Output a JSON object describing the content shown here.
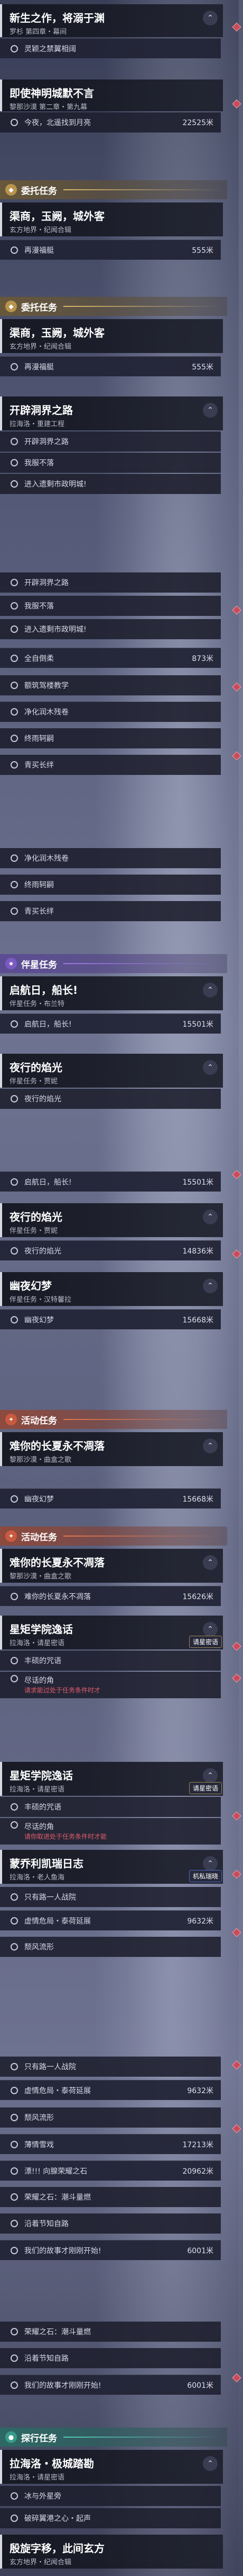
{
  "s1": {
    "card1": {
      "title": "新生之作，将溺于渊",
      "sub": "罗杉 第四章・幕间",
      "collapse": "^"
    },
    "obj1": {
      "text": "灵颖之禁翼相阔",
      "done": true
    },
    "card2": {
      "title": "即使神明城默不言",
      "sub": "黎那沙漠 第二章・第九幕"
    },
    "obj2": {
      "text": "今夜，北遥找到月亮",
      "dist": "22525米"
    }
  },
  "section_commission": {
    "label": "委托任务"
  },
  "s2": {
    "card1": {
      "title": "渠商，玉阙，城外客",
      "sub": "玄方地界・纪闻合辑"
    },
    "obj1": {
      "text": "再漫福艇",
      "dist": "555米"
    }
  },
  "s3": {
    "card1": {
      "title": "渠商，玉阙，城外客",
      "sub": "玄方地界・纪闻合辑"
    },
    "obj1": {
      "text": "再漫福艇",
      "dist": "555米"
    },
    "card2": {
      "title": "开辟洞界之路",
      "sub": "拉海洛・重建工程"
    },
    "objs": [
      {
        "text": "开辟洞界之路"
      },
      {
        "text": "我服不落"
      },
      {
        "text": "进入遗剩市政明城!"
      }
    ]
  },
  "s4": {
    "objs": [
      {
        "text": "开辟洞界之路"
      },
      {
        "text": "我服不落"
      },
      {
        "text": "进入遗剩市政明城!"
      },
      {
        "text": "全自倒柔",
        "dist": "873米"
      },
      {
        "text": "额筑驾楼教学"
      },
      {
        "text": "净化润木残卷"
      },
      {
        "text": "终雨轲嗣"
      },
      {
        "text": "青买长绊"
      }
    ]
  },
  "s5": {
    "objs": [
      {
        "text": "净化润木残卷"
      },
      {
        "text": "终雨轲嗣"
      },
      {
        "text": "青买长绊"
      }
    ]
  },
  "section_companion": {
    "label": "伴星任务"
  },
  "s6": {
    "card1": {
      "title": "启航日，船长!",
      "sub": "伴星任务・布兰特"
    },
    "obj1": {
      "text": "启航日，船长!",
      "dist": "15501米"
    },
    "card2": {
      "title": "夜行的焰光",
      "sub": "伴星任务・贾妮"
    },
    "obj2": {
      "text": "夜行的焰光"
    }
  },
  "s7": {
    "obj1": {
      "text": "启航日，船长!",
      "dist": "15501米"
    },
    "card1": {
      "title": "夜行的焰光",
      "sub": "伴星任务・贾妮"
    },
    "obj2": {
      "text": "夜行的焰光",
      "dist": "14836米"
    },
    "card2": {
      "title": "幽夜幻梦",
      "sub": "伴星任务・汉特馨拉"
    },
    "obj3": {
      "text": "幽夜幻梦",
      "dist": "15668米"
    }
  },
  "section_event": {
    "label": "活动任务"
  },
  "s8": {
    "card1": {
      "title": "难你的长夏永不凋落",
      "sub": "黎那沙漠・曲盒之歌"
    },
    "obj1": {
      "text": "幽夜幻梦",
      "dist": "15668米"
    }
  },
  "s9": {
    "card1": {
      "title": "难你的长夏永不凋落",
      "sub": "黎那沙漠・曲盒之歌"
    },
    "obj1": {
      "text": "难你的长夏永不凋落",
      "dist": "15626米"
    },
    "card2": {
      "title": "星矩学院逸话",
      "sub": "拉海洛・请星密语"
    },
    "tag1": "请星密语",
    "obj2": {
      "text": "丰硕的咒语"
    },
    "obj3": {
      "text": "尽话的角",
      "red": "请求能过处于任务条件时才"
    }
  },
  "s10": {
    "card1": {
      "title": "星矩学院逸话",
      "sub": "拉海洛・请星密语"
    },
    "tag1": "请星密语",
    "obj1": {
      "text": "丰硕的咒语"
    },
    "obj2": {
      "text": "尽话的角",
      "red": "请你取进处于任务条件时才能"
    },
    "card2": {
      "title": "蒙乔利凯瑞日志",
      "sub": "拉海洛・老人鱼海"
    },
    "tag2": "机私瑞晓",
    "obj3": {
      "text": "只有路一人战院"
    },
    "obj4": {
      "text": "虚情危局・泰荷延展",
      "dist": "9632米"
    },
    "obj5": {
      "text": "颓风流形"
    }
  },
  "s11": {
    "objs": [
      {
        "text": "只有路一人战院"
      },
      {
        "text": "虚情危局・泰荷延展",
        "dist": "9632米"
      },
      {
        "text": "颓风流形"
      },
      {
        "text": "薄情雪戏",
        "dist": "17213米"
      },
      {
        "text": "漂!!! 向腺荣耀之石",
        "dist": "20962米"
      },
      {
        "text": "荣耀之石：潮斗量燃"
      },
      {
        "text": "沿着节知自路"
      },
      {
        "text": "我们的故事才刚刚开始!",
        "dist": "6001米"
      }
    ]
  },
  "s12": {
    "objs": [
      {
        "text": "荣耀之石：潮斗量燃"
      },
      {
        "text": "沿着节知自路"
      },
      {
        "text": "我们的故事才刚刚开始!",
        "dist": "6001米"
      }
    ]
  },
  "section_explore": {
    "label": "探行任务"
  },
  "s13": {
    "card1": {
      "title": "拉海洛・极城踏勘",
      "sub": "拉海洛・请星密语"
    },
    "objs": [
      {
        "text": "冰与外星旁"
      },
      {
        "text": "破碎翼港之心・起声"
      }
    ],
    "card2": {
      "title": "殷旋字移，此间玄方",
      "sub": "玄方地界・纪闻合辑"
    }
  }
}
